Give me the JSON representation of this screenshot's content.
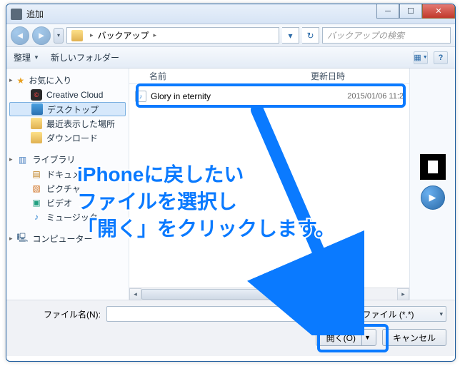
{
  "window": {
    "title": "追加",
    "blurred_extra": "     "
  },
  "nav": {
    "breadcrumb_folder": "バックアップ",
    "search_placeholder": "バックアップの検索"
  },
  "toolbar": {
    "organize": "整理",
    "new_folder": "新しいフォルダー"
  },
  "sidebar": {
    "favorites": {
      "label": "お気に入り",
      "items": [
        {
          "label": "Creative Cloud"
        },
        {
          "label": "デスクトップ"
        },
        {
          "label": "最近表示した場所"
        },
        {
          "label": "ダウンロード"
        }
      ]
    },
    "libraries": {
      "label": "ライブラリ",
      "items": [
        {
          "label": "ドキュメ"
        },
        {
          "label": "ピクチャ"
        },
        {
          "label": "ビデオ"
        },
        {
          "label": "ミュージック"
        }
      ]
    },
    "computer": {
      "label": "コンピューター"
    }
  },
  "filelist": {
    "col_name": "名前",
    "col_date": "更新日時",
    "rows": [
      {
        "name": "Glory in eternity",
        "date": "2015/01/06 11:2"
      }
    ]
  },
  "bottom": {
    "filename_label": "ファイル名(N):",
    "filter_label": "べてのファイル (*.*)",
    "open": "開く(O)",
    "cancel": "キャンセル"
  },
  "annotation": {
    "text": "iPhoneに戻したい\nファイルを選択し\n「開く」をクリックします。"
  }
}
